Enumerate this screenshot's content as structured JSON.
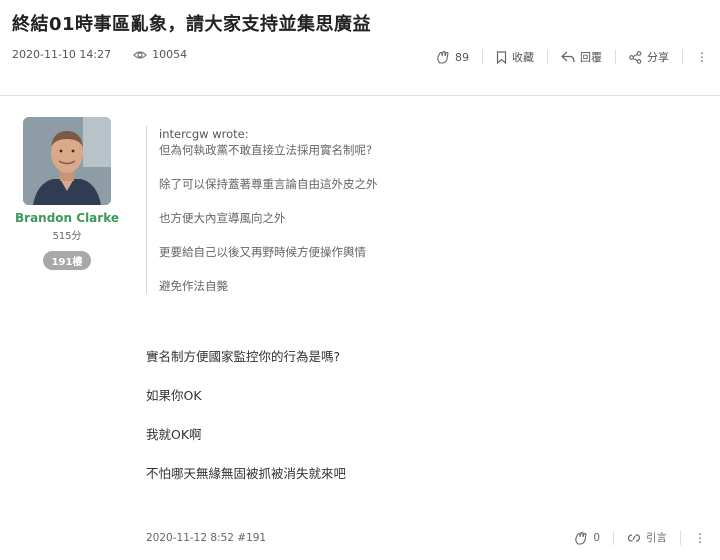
{
  "thread": {
    "title": "終結01時事區亂象，請大家支持並集思廣益",
    "posted_at": "2020-11-10 14:27",
    "views": "10054",
    "like_count": "89",
    "bookmark_label": "收藏",
    "reply_label": "回覆",
    "share_label": "分享",
    "more_label": "⋮"
  },
  "post": {
    "author": {
      "name": "Brandon Clarke",
      "score": "515分",
      "floor_badge": "191樓"
    },
    "quote": {
      "author_line": "intercgw wrote:",
      "lines": [
        "但為何執政黨不敢直接立法採用實名制呢?",
        "除了可以保持蓋著尊重言論自由這外皮之外",
        "也方便大內宣導風向之外",
        "更要給自己以後又再野時候方便操作輿情",
        "避免作法自斃"
      ]
    },
    "body": [
      "實名制方便國家監控你的行為是嗎?",
      "如果你OK",
      "我就OK啊",
      "不怕哪天無緣無固被抓被消失就來吧"
    ],
    "footer": {
      "stamp": "2020-11-12 8:52 #191",
      "like_count": "0",
      "quote_label": "引言",
      "more_label": "⋮"
    }
  },
  "colors": {
    "username": "#3c9a5a",
    "divider": "#cfe3df",
    "badge": "#a8a8a8"
  }
}
